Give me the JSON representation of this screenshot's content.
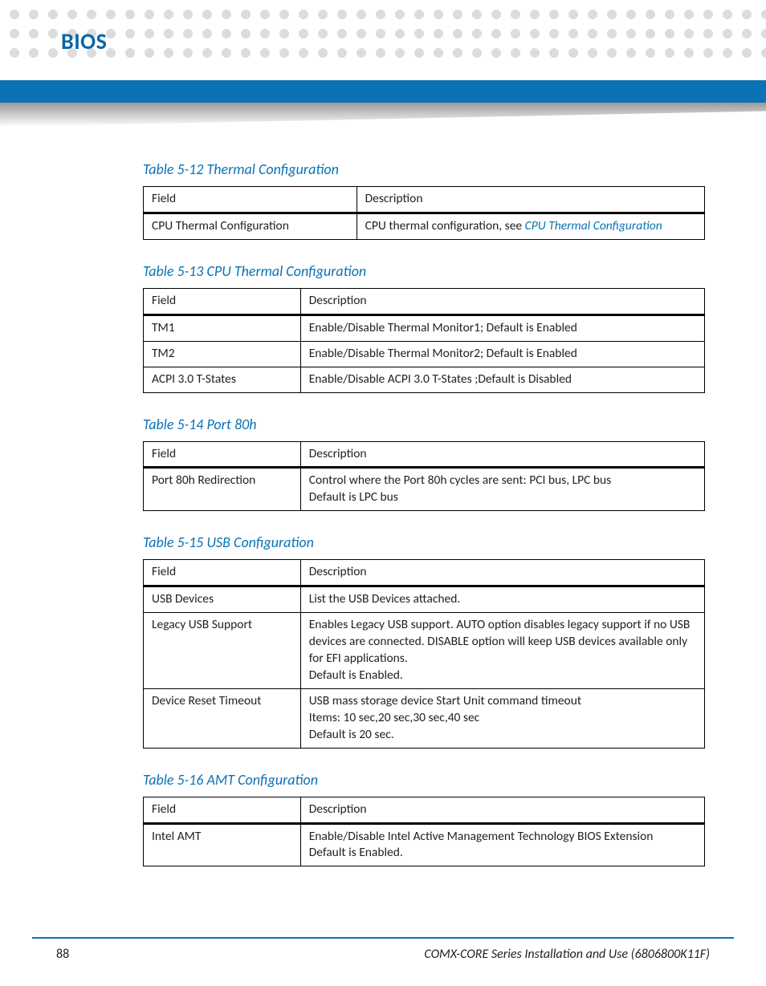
{
  "chapter_title": "BIOS",
  "tables": [
    {
      "caption": "Table 5-12 Thermal Configuration",
      "head_field": "Field",
      "head_desc": "Description",
      "rows": [
        {
          "field": "CPU Thermal Configuration",
          "desc_prefix": "CPU thermal configuration, see ",
          "desc_xref": "CPU Thermal Configuration"
        }
      ]
    },
    {
      "caption": "Table 5-13 CPU Thermal Configuration",
      "head_field": "Field",
      "head_desc": "Description",
      "rows": [
        {
          "field": "TM1",
          "desc": "Enable/Disable Thermal Monitor1; Default is Enabled"
        },
        {
          "field": "TM2",
          "desc": "Enable/Disable Thermal Monitor2; Default is Enabled"
        },
        {
          "field": "ACPI 3.0 T-States",
          "desc": "Enable/Disable ACPI 3.0 T-States ;Default is Disabled"
        }
      ]
    },
    {
      "caption": "Table 5-14 Port 80h",
      "head_field": "Field",
      "head_desc": "Description",
      "rows": [
        {
          "field": "Port 80h Redirection",
          "desc": "Control where the Port 80h cycles are sent: PCI bus, LPC bus\nDefault is LPC bus"
        }
      ]
    },
    {
      "caption": "Table 5-15 USB Configuration",
      "head_field": "Field",
      "head_desc": "Description",
      "rows": [
        {
          "field": "USB Devices",
          "desc": "List the USB Devices attached."
        },
        {
          "field": "Legacy USB Support",
          "desc": "Enables Legacy USB support. AUTO option disables legacy support if no USB devices are connected. DISABLE option will keep USB devices available only for EFI applications.\nDefault is Enabled."
        },
        {
          "field": "Device Reset Timeout",
          "desc": "USB mass storage device Start Unit command timeout\nItems: 10 sec,20 sec,30 sec,40 sec\nDefault is 20 sec."
        }
      ]
    },
    {
      "caption": "Table 5-16 AMT Configuration",
      "head_field": "Field",
      "head_desc": "Description",
      "rows": [
        {
          "field": "Intel AMT",
          "desc": "Enable/Disable Intel Active Management Technology BIOS Extension\nDefault is Enabled."
        }
      ]
    }
  ],
  "footer": {
    "page_number": "88",
    "doc_title": "COMX-CORE Series Installation and Use (6806800K11F)"
  }
}
